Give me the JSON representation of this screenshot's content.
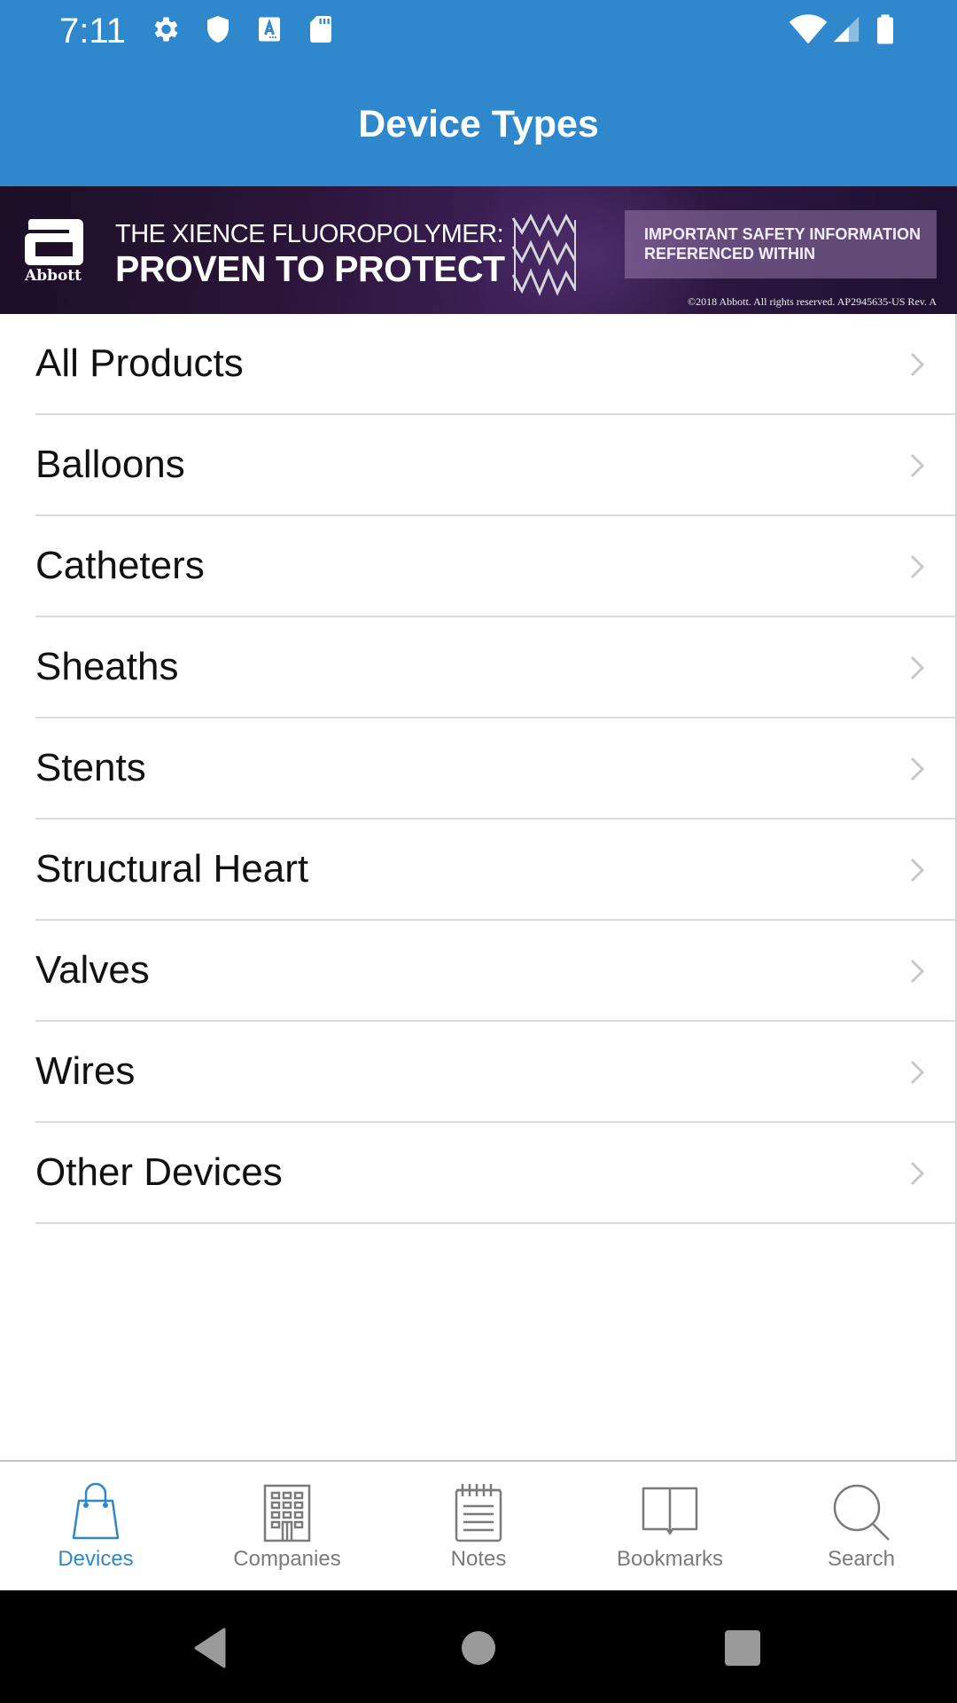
{
  "status_bar": {
    "time": "7:11",
    "left_icons": [
      "settings-icon",
      "shield-icon",
      "font-a-icon",
      "sd-card-icon"
    ],
    "right_icons": [
      "wifi-icon",
      "cell-signal-icon",
      "battery-icon"
    ]
  },
  "app_bar": {
    "title": "Device Types"
  },
  "banner": {
    "brand": "Abbott",
    "line1": "THE XIENCE FLUOROPOLYMER:",
    "line2": "PROVEN TO PROTECT",
    "isi_line1": "IMPORTANT SAFETY INFORMATION",
    "isi_line2": "REFERENCED WITHIN",
    "copyright": "©2018 Abbott. All rights reserved. AP2945635-US Rev. A"
  },
  "device_types": [
    {
      "label": "All Products"
    },
    {
      "label": "Balloons"
    },
    {
      "label": "Catheters"
    },
    {
      "label": "Sheaths"
    },
    {
      "label": "Stents"
    },
    {
      "label": "Structural Heart"
    },
    {
      "label": "Valves"
    },
    {
      "label": "Wires"
    },
    {
      "label": "Other Devices"
    }
  ],
  "tabs": [
    {
      "label": "Devices",
      "icon": "shopping-bag-icon",
      "active": true
    },
    {
      "label": "Companies",
      "icon": "building-icon",
      "active": false
    },
    {
      "label": "Notes",
      "icon": "notepad-icon",
      "active": false
    },
    {
      "label": "Bookmarks",
      "icon": "book-icon",
      "active": false
    },
    {
      "label": "Search",
      "icon": "search-icon",
      "active": false
    }
  ],
  "colors": {
    "primary": "#2f88cc",
    "tab_inactive": "#7a7a7a",
    "chevron": "#c8c8c8",
    "divider": "#dcdcdc"
  }
}
